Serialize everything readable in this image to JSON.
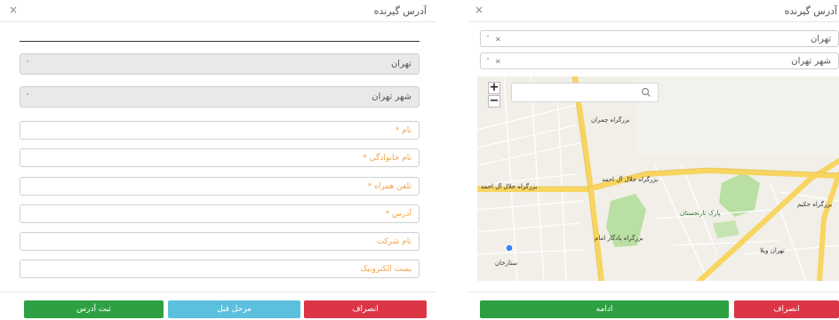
{
  "left": {
    "title": "آدرس گیرنده",
    "close": "×",
    "province": "تهران",
    "city": "شهر تهران",
    "fields": [
      "نام *",
      "نام خانوادگی *",
      "تلفن همراه *",
      "آدرس *",
      "نام شرکت",
      "پست الکترونیک"
    ],
    "buttons": {
      "submit": "ثبت آدرس",
      "previous": "مرحل قبل",
      "cancel": "انصراف"
    }
  },
  "right": {
    "title": "آدرس گیرنده",
    "close": "×",
    "province": "تهران",
    "city": "شهر تهران",
    "select_controls": {
      "arrow": "˅",
      "clear": "×"
    },
    "map": {
      "zoom_in": "+",
      "zoom_out": "−",
      "search_placeholder": "",
      "labels": [
        "بزرگراه جلال آل احمد",
        "بزرگراه چمران",
        "بزرگراه جلال آل احمد",
        "بزرگراه یادگار امام",
        "پارک نارنجستان",
        "تهران ویلا",
        "ستارخان",
        "بزرگراه حکیم"
      ]
    },
    "buttons": {
      "continue": "ادامه",
      "cancel": "انصراف"
    }
  },
  "colors": {
    "green": "#2ea043",
    "blue": "#5bc0de",
    "red": "#dc3545",
    "placeholder_orange": "#f0a34c",
    "road_yellow": "#f7d560",
    "park_green": "#b9dfa3"
  },
  "icons": [
    "close-icon",
    "chevron-down-icon",
    "search-icon",
    "location-pin-icon"
  ]
}
